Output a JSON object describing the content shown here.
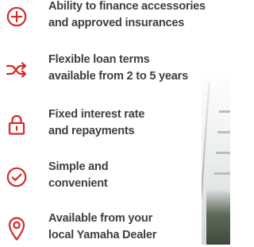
{
  "colors": {
    "icon_red": "#d52b2b",
    "text_dark": "#3d3f45"
  },
  "features": [
    {
      "icon": "plus-circle-icon",
      "line1": "Ability to finance accessories",
      "line2": "and approved insurances"
    },
    {
      "icon": "shuffle-icon",
      "line1": "Flexible loan terms",
      "line2": "available from 2 to 5 years"
    },
    {
      "icon": "padlock-icon",
      "line1": "Fixed interest rate",
      "line2": "and repayments"
    },
    {
      "icon": "checkmark-circle-icon",
      "line1": "Simple and",
      "line2": "convenient"
    },
    {
      "icon": "location-pin-icon",
      "line1": "Available from your",
      "line2": "local Yamaha Dealer"
    }
  ]
}
